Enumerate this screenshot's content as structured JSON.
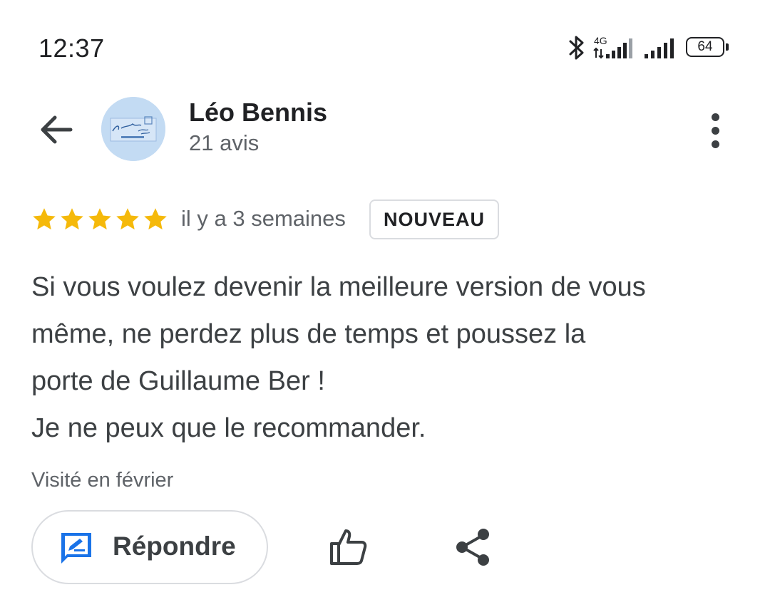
{
  "status_bar": {
    "time": "12:37",
    "network_type": "4G",
    "battery_level": "64",
    "icons": [
      "bluetooth-icon",
      "signal-4g-icon",
      "signal-icon",
      "battery-icon"
    ]
  },
  "header": {
    "back_icon": "arrow-back-icon",
    "avatar_icon": "profile-avatar",
    "reviewer_name": "Léo Bennis",
    "review_count": "21 avis",
    "more_icon": "more-vert-icon"
  },
  "review": {
    "rating": 5,
    "rating_max": 5,
    "date": "il y a 3 semaines",
    "badge": "NOUVEAU",
    "text_lines": [
      "Si vous voulez devenir la meilleure version de vous",
      "même, ne perdez plus de temps et poussez la",
      "porte de Guillaume Ber !",
      "Je ne peux que le recommander."
    ],
    "visited": "Visité en février"
  },
  "actions": {
    "reply_label": "Répondre",
    "reply_icon": "rate-review-icon",
    "like_icon": "thumb-up-icon",
    "share_icon": "share-icon"
  },
  "colors": {
    "star": "#f5b90a",
    "reply_icon": "#1a73e8",
    "text": "#3c4043",
    "secondary_text": "#5f6368",
    "border": "#dadce0"
  }
}
